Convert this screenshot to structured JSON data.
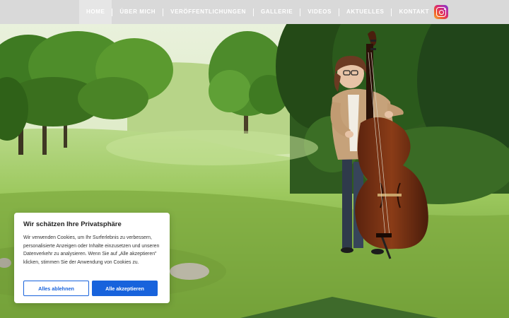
{
  "nav": {
    "items": [
      {
        "label": "HOME",
        "active": true
      },
      {
        "label": "ÜBER MICH",
        "active": false
      },
      {
        "label": "VERÖFFENTLICHUNGEN",
        "active": false
      },
      {
        "label": "GALLERIE",
        "active": false
      },
      {
        "label": "VIDEOS",
        "active": false
      },
      {
        "label": "AKTUELLES",
        "active": false
      },
      {
        "label": "KONTAKT",
        "active": false
      }
    ],
    "social_icon": "instagram-icon"
  },
  "hero": {
    "image_subject": "double-bass-player-on-meadow"
  },
  "cookie": {
    "title": "Wir schätzen Ihre Privatsphäre",
    "text": "Wir verwenden Cookies, um Ihr Surferlebnis zu verbessern, personalisierte Anzeigen oder Inhalte einzusetzen und unseren Datenverkehr zu analysieren. Wenn Sie auf „Alle akzeptieren\" klicken, stimmen Sie der Anwendung von Cookies zu.",
    "reject_label": "Alles ablehnen",
    "accept_label": "Alle akzeptieren",
    "accent_color": "#1863dc"
  },
  "colors": {
    "navbar_bg": "#d9d9d9",
    "nav_text": "#ffffff",
    "meadow": "#8fbf4a"
  }
}
